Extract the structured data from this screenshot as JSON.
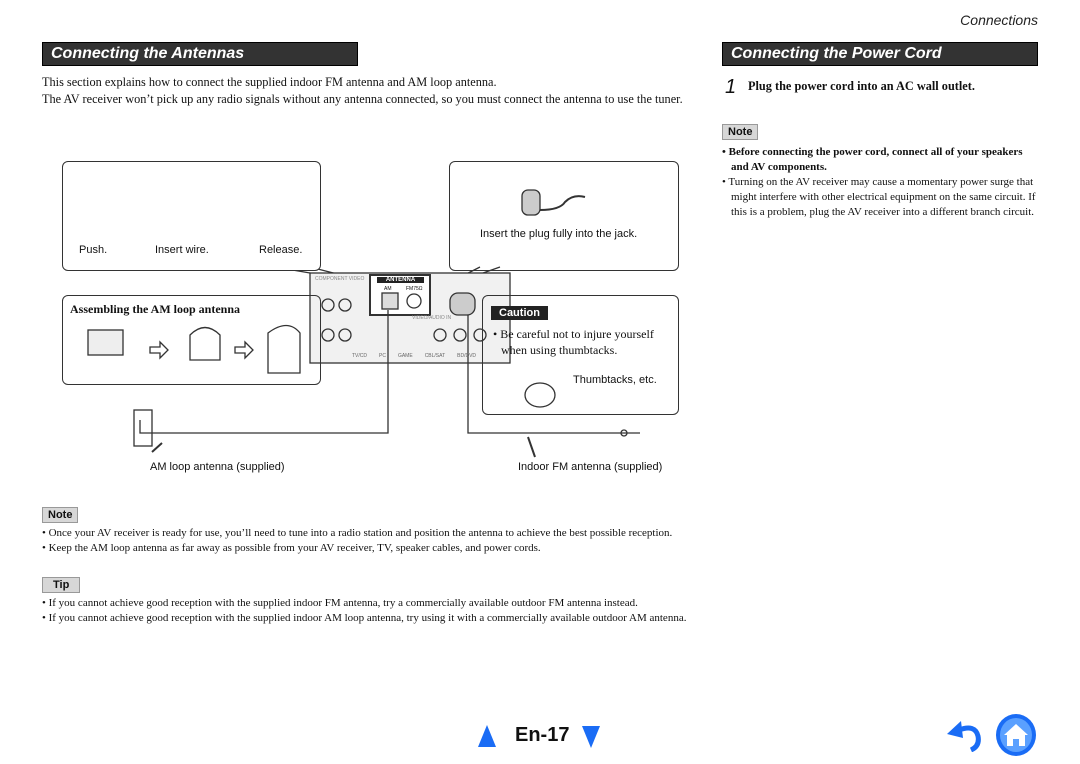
{
  "header": {
    "section": "Connections"
  },
  "left": {
    "title": "Connecting the Antennas",
    "intro": [
      "This section explains how to connect the supplied indoor FM antenna and AM loop antenna.",
      "The AV receiver won’t pick up any radio signals without any antenna connected, so you must connect the antenna to use the tuner."
    ],
    "diagram": {
      "steps": [
        "Push.",
        "Insert wire.",
        "Release."
      ],
      "plug_caption": "Insert the plug fully into the jack.",
      "am_assembly_title": "Assembling the AM loop antenna",
      "caution_label": "Caution",
      "caution_text": "Be careful not to injure yourself when using thumbtacks.",
      "thumbtacks": "Thumbtacks, etc.",
      "am_label": "AM loop antenna (supplied)",
      "fm_label": "Indoor FM antenna (supplied)",
      "panel": {
        "antenna": "ANTENNA",
        "am": "AM",
        "fm": "FM75Ω",
        "video_audio_in": "VIDEO/AUDIO IN",
        "component_video": "COMPONENT VIDEO",
        "inputs": [
          "TV/CD",
          "PC",
          "GAME",
          "CBL/SAT",
          "BD/DVD"
        ]
      }
    },
    "note_label": "Note",
    "notes": [
      "Once your AV receiver is ready for use, you’ll need to tune into a radio station and position the antenna to achieve the best possible reception.",
      "Keep the AM loop antenna as far away as possible from your AV receiver, TV, speaker cables, and power cords."
    ],
    "tip_label": "Tip",
    "tips": [
      "If you cannot achieve good reception with the supplied indoor FM antenna, try a commercially available outdoor FM antenna instead.",
      "If you cannot achieve good reception with the supplied indoor AM loop antenna, try using it with a commercially available outdoor AM antenna."
    ]
  },
  "right": {
    "title": "Connecting the Power Cord",
    "step_number": "1",
    "step_text": "Plug the power cord into an AC wall outlet.",
    "note_label": "Note",
    "notes": [
      "Before connecting the power cord, connect all of your speakers and AV components.",
      "Turning on the AV receiver may cause a momentary power surge that might interfere with other electrical equipment on the same circuit. If this is a problem, plug the AV receiver into a different branch circuit."
    ]
  },
  "footer": {
    "page": "En-17",
    "accent": "#1a6cf5"
  }
}
